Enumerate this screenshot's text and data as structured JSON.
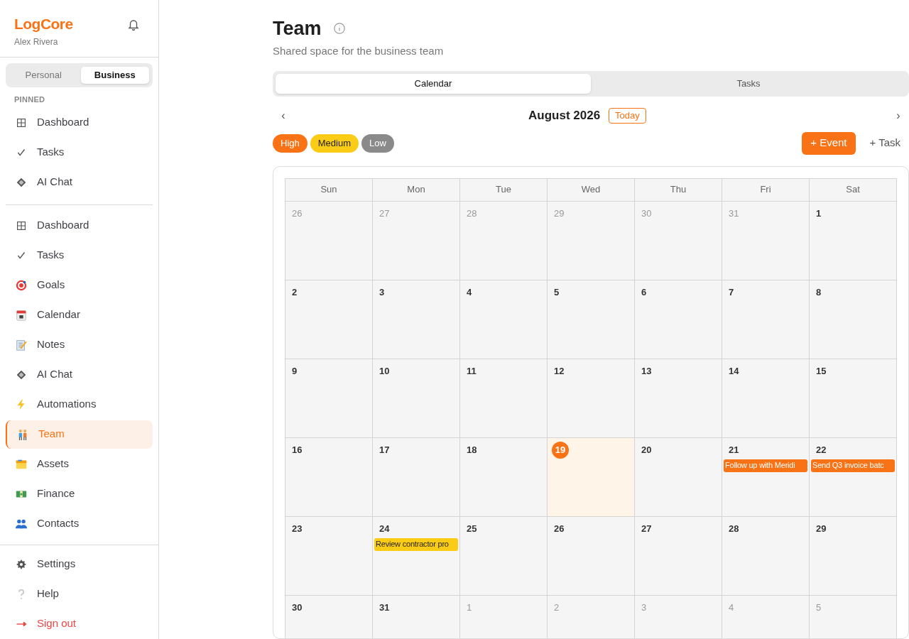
{
  "sidebar": {
    "brand": "LogCore",
    "user": "Alex Rivera",
    "spaces": [
      {
        "label": "Personal",
        "selected": false
      },
      {
        "label": "Business",
        "selected": true
      }
    ],
    "pinned_label": "PINNED",
    "pinned": [
      {
        "label": "Dashboard",
        "kind": "grid"
      },
      {
        "label": "Tasks",
        "kind": "check"
      },
      {
        "label": "AI Chat",
        "kind": "diamond"
      }
    ],
    "items": [
      {
        "label": "Dashboard",
        "kind": "grid",
        "selected": false
      },
      {
        "label": "Tasks",
        "kind": "check",
        "selected": false
      },
      {
        "label": "Goals",
        "kind": "target",
        "selected": false
      },
      {
        "label": "Calendar",
        "kind": "calendar",
        "selected": false
      },
      {
        "label": "Notes",
        "kind": "memo",
        "selected": false
      },
      {
        "label": "AI Chat",
        "kind": "diamond",
        "selected": false
      },
      {
        "label": "Automations",
        "kind": "bolt",
        "selected": false
      },
      {
        "label": "Team",
        "kind": "people",
        "selected": true
      },
      {
        "label": "Assets",
        "kind": "folder",
        "selected": false
      },
      {
        "label": "Finance",
        "kind": "money",
        "selected": false
      },
      {
        "label": "Contacts",
        "kind": "contacts",
        "selected": false
      }
    ],
    "footer": [
      {
        "label": "Settings",
        "kind": "gear"
      },
      {
        "label": "Help",
        "kind": "question"
      },
      {
        "label": "Sign out",
        "kind": "signout"
      }
    ]
  },
  "page": {
    "title": "Team",
    "subtitle": "Shared space for the business team"
  },
  "tabs": [
    {
      "label": "Calendar",
      "selected": true
    },
    {
      "label": "Tasks",
      "selected": false
    }
  ],
  "calendar": {
    "prev": "‹",
    "month": "August 2026",
    "today_button": "Today",
    "next": "›",
    "priorities": [
      {
        "label": "High",
        "kind": "high"
      },
      {
        "label": "Medium",
        "kind": "medium"
      },
      {
        "label": "Low",
        "kind": "low"
      }
    ],
    "add_event": "+ Event",
    "add_task": "+ Task",
    "weekdays": [
      "Sun",
      "Mon",
      "Tue",
      "Wed",
      "Thu",
      "Fri",
      "Sat"
    ],
    "days": [
      {
        "date": "26",
        "muted": true
      },
      {
        "date": "27",
        "muted": true
      },
      {
        "date": "28",
        "muted": true
      },
      {
        "date": "29",
        "muted": true
      },
      {
        "date": "30",
        "muted": true
      },
      {
        "date": "31",
        "muted": true
      },
      {
        "date": "1",
        "muted": false
      },
      {
        "date": "2",
        "muted": false
      },
      {
        "date": "3",
        "muted": false
      },
      {
        "date": "4",
        "muted": false
      },
      {
        "date": "5",
        "muted": false
      },
      {
        "date": "6",
        "muted": false
      },
      {
        "date": "7",
        "muted": false
      },
      {
        "date": "8",
        "muted": false
      },
      {
        "date": "9",
        "muted": false
      },
      {
        "date": "10",
        "muted": false
      },
      {
        "date": "11",
        "muted": false
      },
      {
        "date": "12",
        "muted": false
      },
      {
        "date": "13",
        "muted": false
      },
      {
        "date": "14",
        "muted": false
      },
      {
        "date": "15",
        "muted": false
      },
      {
        "date": "16",
        "muted": false
      },
      {
        "date": "17",
        "muted": false
      },
      {
        "date": "18",
        "muted": false
      },
      {
        "date": "19",
        "muted": false,
        "today": true
      },
      {
        "date": "20",
        "muted": false
      },
      {
        "date": "21",
        "muted": false,
        "events": [
          {
            "title": "Follow up with Meridi",
            "kind": "high"
          }
        ]
      },
      {
        "date": "22",
        "muted": false,
        "events": [
          {
            "title": "Send Q3 invoice batc",
            "kind": "high"
          }
        ]
      },
      {
        "date": "23",
        "muted": false
      },
      {
        "date": "24",
        "muted": false,
        "events": [
          {
            "title": "Review contractor pro",
            "kind": "medium"
          }
        ]
      },
      {
        "date": "25",
        "muted": false
      },
      {
        "date": "26",
        "muted": false
      },
      {
        "date": "27",
        "muted": false
      },
      {
        "date": "28",
        "muted": false
      },
      {
        "date": "29",
        "muted": false
      },
      {
        "date": "30",
        "muted": false
      },
      {
        "date": "31",
        "muted": false
      },
      {
        "date": "1",
        "muted": true
      },
      {
        "date": "2",
        "muted": true
      },
      {
        "date": "3",
        "muted": true
      },
      {
        "date": "4",
        "muted": true
      },
      {
        "date": "5",
        "muted": true
      }
    ]
  }
}
